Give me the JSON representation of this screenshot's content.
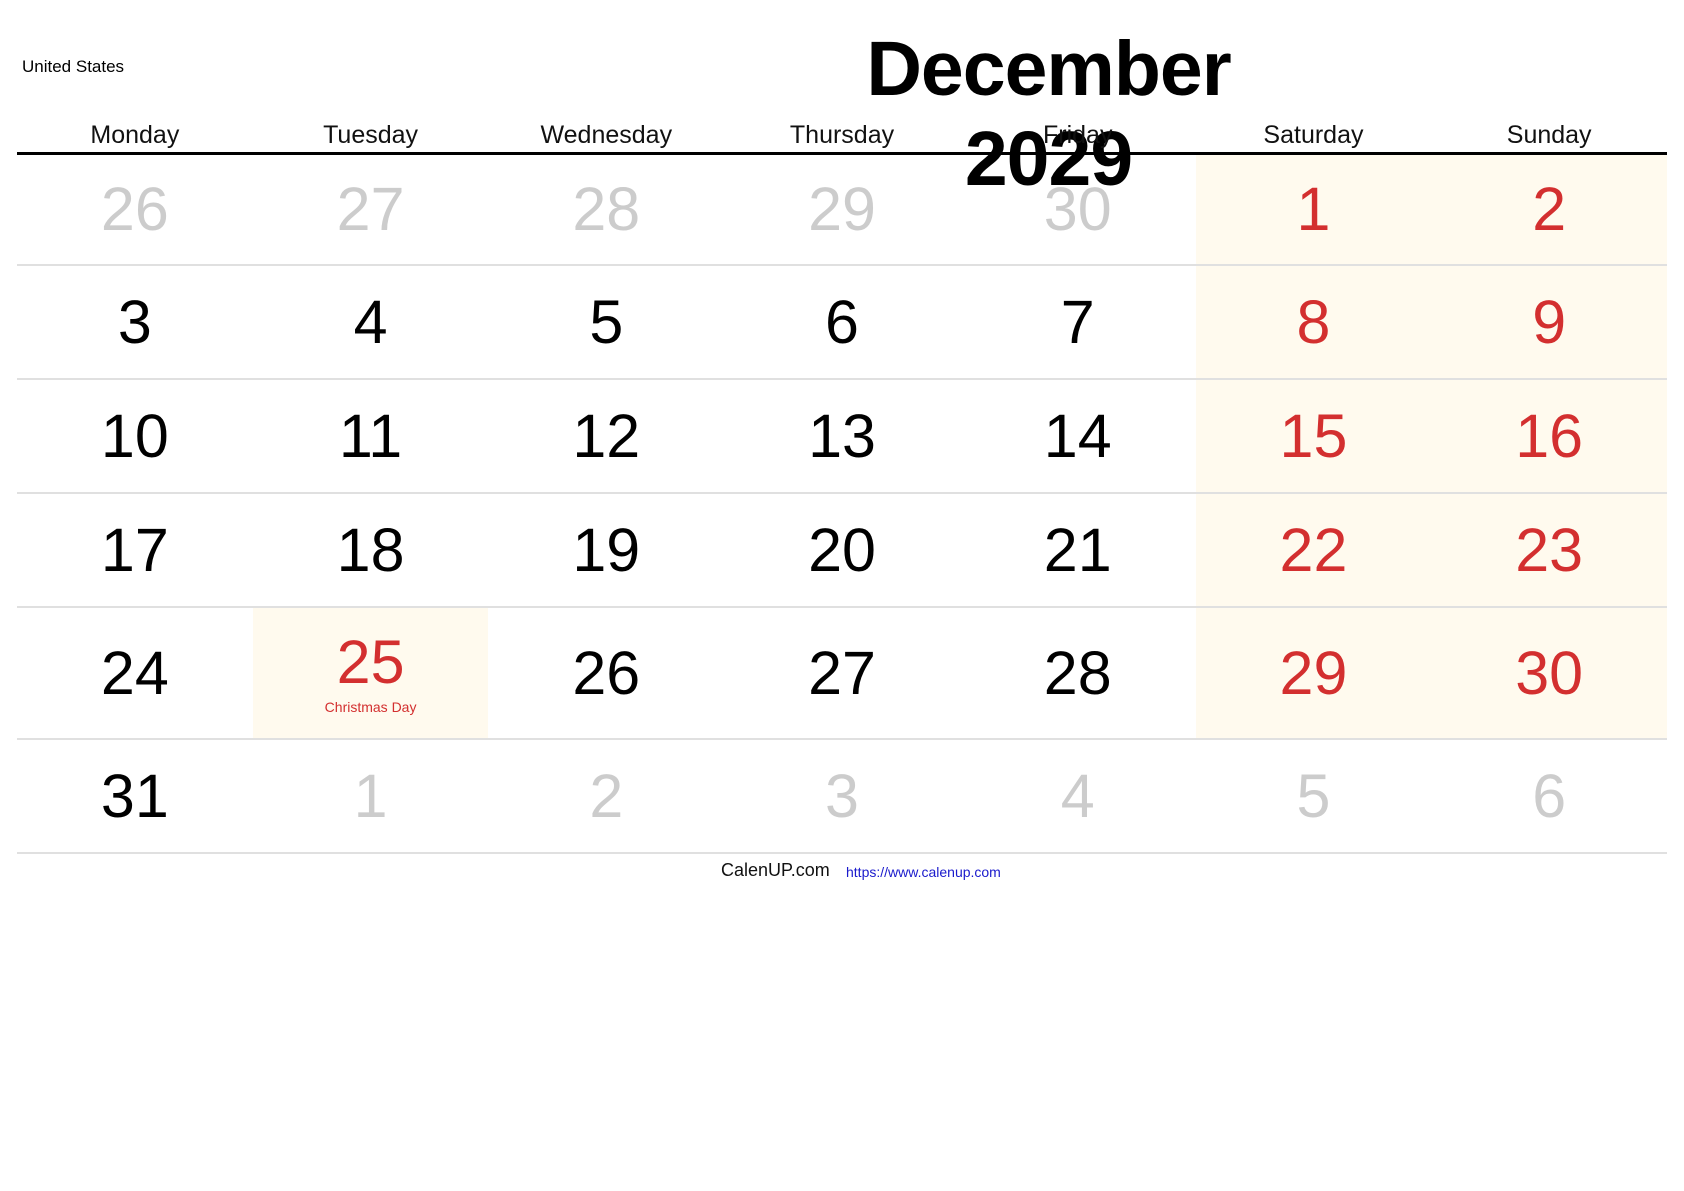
{
  "country": "United States",
  "title": "December 2029",
  "weekdays": [
    "Monday",
    "Tuesday",
    "Wednesday",
    "Thursday",
    "Friday",
    "Saturday",
    "Sunday"
  ],
  "colors": {
    "weekend_text": "#d32f2f",
    "weekend_bg": "#fffaee",
    "other_month_text": "#cccccc",
    "link": "#1a1acc"
  },
  "weeks": [
    [
      {
        "day": "26",
        "other": true
      },
      {
        "day": "27",
        "other": true
      },
      {
        "day": "28",
        "other": true
      },
      {
        "day": "29",
        "other": true
      },
      {
        "day": "30",
        "other": true
      },
      {
        "day": "1",
        "weekend": true
      },
      {
        "day": "2",
        "weekend": true
      }
    ],
    [
      {
        "day": "3"
      },
      {
        "day": "4"
      },
      {
        "day": "5"
      },
      {
        "day": "6"
      },
      {
        "day": "7"
      },
      {
        "day": "8",
        "weekend": true
      },
      {
        "day": "9",
        "weekend": true
      }
    ],
    [
      {
        "day": "10"
      },
      {
        "day": "11"
      },
      {
        "day": "12"
      },
      {
        "day": "13"
      },
      {
        "day": "14"
      },
      {
        "day": "15",
        "weekend": true
      },
      {
        "day": "16",
        "weekend": true
      }
    ],
    [
      {
        "day": "17"
      },
      {
        "day": "18"
      },
      {
        "day": "19"
      },
      {
        "day": "20"
      },
      {
        "day": "21"
      },
      {
        "day": "22",
        "weekend": true
      },
      {
        "day": "23",
        "weekend": true
      }
    ],
    [
      {
        "day": "24"
      },
      {
        "day": "25",
        "holiday": "Christmas Day"
      },
      {
        "day": "26"
      },
      {
        "day": "27"
      },
      {
        "day": "28"
      },
      {
        "day": "29",
        "weekend": true
      },
      {
        "day": "30",
        "weekend": true
      }
    ],
    [
      {
        "day": "31"
      },
      {
        "day": "1",
        "other": true
      },
      {
        "day": "2",
        "other": true
      },
      {
        "day": "3",
        "other": true
      },
      {
        "day": "4",
        "other": true
      },
      {
        "day": "5",
        "other": true
      },
      {
        "day": "6",
        "other": true
      }
    ]
  ],
  "footer": {
    "brand": "CalenUP.com",
    "link": "https://www.calenup.com"
  }
}
